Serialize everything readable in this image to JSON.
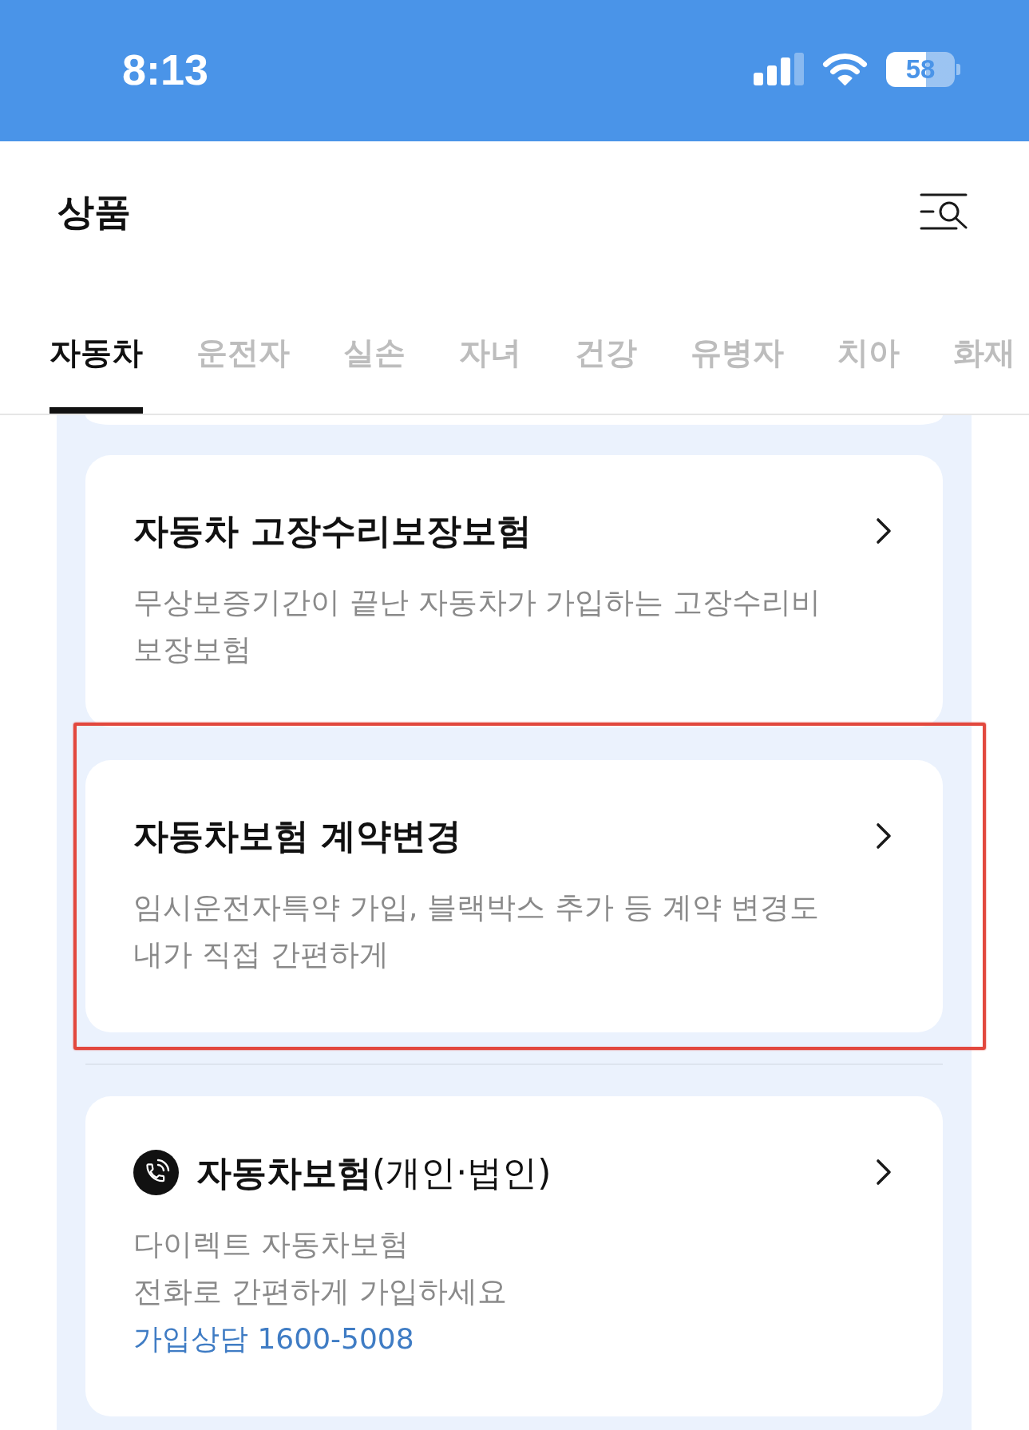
{
  "status_bar": {
    "time": "8:13",
    "battery": "58"
  },
  "header": {
    "title": "상품"
  },
  "tabs": [
    {
      "label": "자동차",
      "selected": true
    },
    {
      "label": "운전자",
      "selected": false
    },
    {
      "label": "실손",
      "selected": false
    },
    {
      "label": "자녀",
      "selected": false
    },
    {
      "label": "건강",
      "selected": false
    },
    {
      "label": "유병자",
      "selected": false
    },
    {
      "label": "치아",
      "selected": false
    },
    {
      "label": "화재",
      "selected": false
    }
  ],
  "product_groups": [
    {
      "items": [
        {
          "kind": "plain",
          "title": "자동차 고장수리보장보험",
          "description": "무상보증기간이 끝난 자동차가 가입하는 고장수리비\n보장보험",
          "highlighted": false
        },
        {
          "kind": "plain",
          "title": "자동차보험 계약변경",
          "description": "임시운전자특약 가입, 블랙박스 추가 등 계약 변경도\n내가 직접 간편하게",
          "highlighted": true
        }
      ]
    },
    {
      "items": [
        {
          "kind": "phone",
          "title": "**자동차보험**(개인·법인)",
          "description": "다이렉트 자동차보험\n전화로 간편하게 가입하세요",
          "contact": "가입상담 1600-5008",
          "highlighted": false
        }
      ]
    }
  ]
}
